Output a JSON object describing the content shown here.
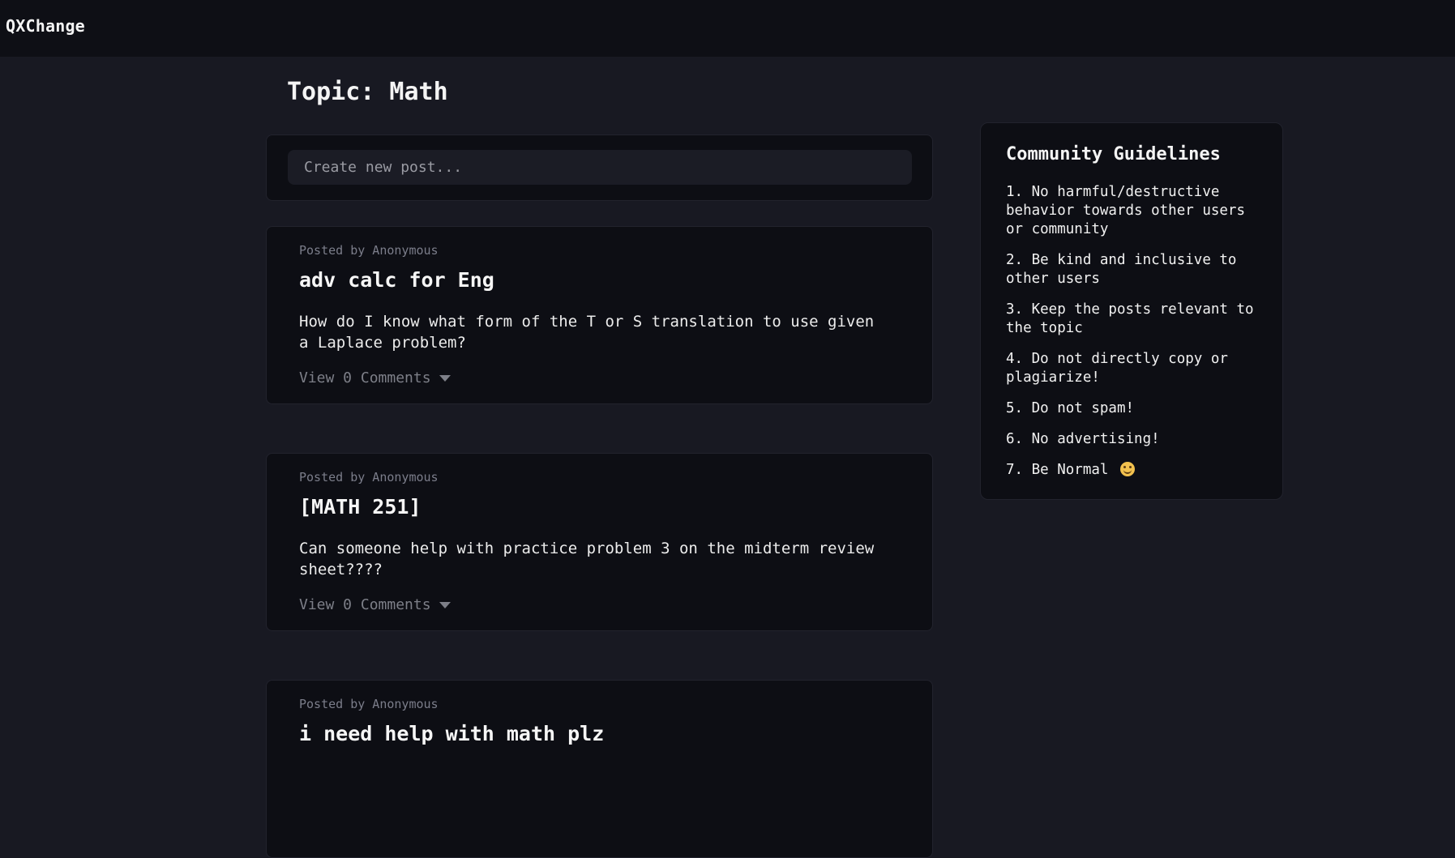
{
  "app": {
    "brand": "QXChange"
  },
  "page": {
    "title": "Topic: Math"
  },
  "new_post": {
    "placeholder": "Create new post..."
  },
  "posts": [
    {
      "meta": "Posted by Anonymous",
      "title": "adv calc for Eng",
      "body": "How do I know what form of the T or S translation to use given a Laplace problem?",
      "comments_label": "View 0 Comments"
    },
    {
      "meta": "Posted by Anonymous",
      "title": "[MATH 251]",
      "body": "Can someone help with practice problem 3 on the midterm review sheet????",
      "comments_label": "View 0 Comments"
    },
    {
      "meta": "Posted by Anonymous",
      "title": "i need help with math plz",
      "body": "",
      "comments_label": ""
    }
  ],
  "guidelines": {
    "title": "Community Guidelines",
    "items": [
      "1. No harmful/destructive behavior towards other users or community",
      "2. Be kind and inclusive to other users",
      "3. Keep the posts relevant to the topic",
      "4. Do not directly copy or plagiarize!",
      "5. Do not spam!",
      "6. No advertising!",
      "7. Be Normal"
    ],
    "last_item_icon": "smile-emoji-icon"
  },
  "colors": {
    "page_background": "#181922",
    "topbar_background": "#0e0f15",
    "card_background": "#0d0e14",
    "muted_text": "#7b7d8a"
  }
}
